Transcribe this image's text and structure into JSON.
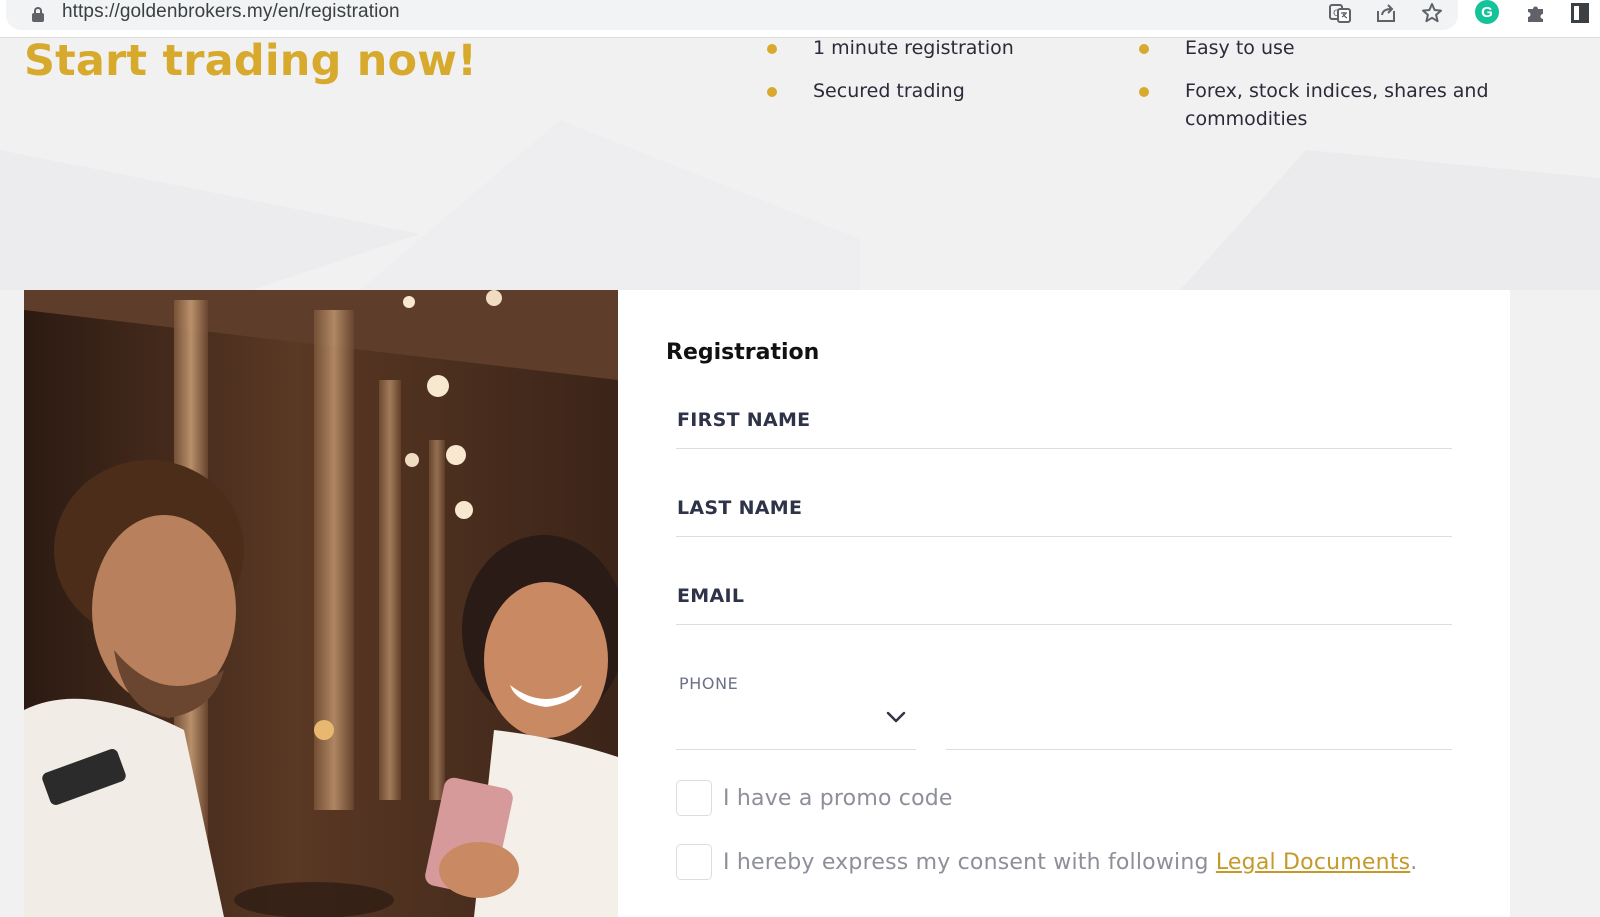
{
  "browser": {
    "url": "https://goldenbrokers.my/en/registration",
    "icons": [
      "lock-icon",
      "translate-icon",
      "share-icon",
      "star-icon",
      "grammarly-icon",
      "extensions-icon",
      "side-panel-icon"
    ],
    "grammarly_letter": "G"
  },
  "hero": {
    "title": "Start trading now!",
    "features": [
      "1 minute registration",
      "Easy to use",
      "Secured trading",
      "Forex, stock indices, shares and commodities"
    ]
  },
  "form": {
    "title": "Registration",
    "first_name_label": "FIRST NAME",
    "last_name_label": "LAST NAME",
    "email_label": "EMAIL",
    "phone_label": "PHONE",
    "promo_label": "I have a promo code",
    "consent_prefix": "I hereby express my consent with following ",
    "consent_link": "Legal Documents",
    "consent_suffix": "."
  },
  "colors": {
    "accent": "#d7aa2d",
    "link": "#c59a2b",
    "label": "#2f3348",
    "page_background": "#f1f1f2"
  }
}
